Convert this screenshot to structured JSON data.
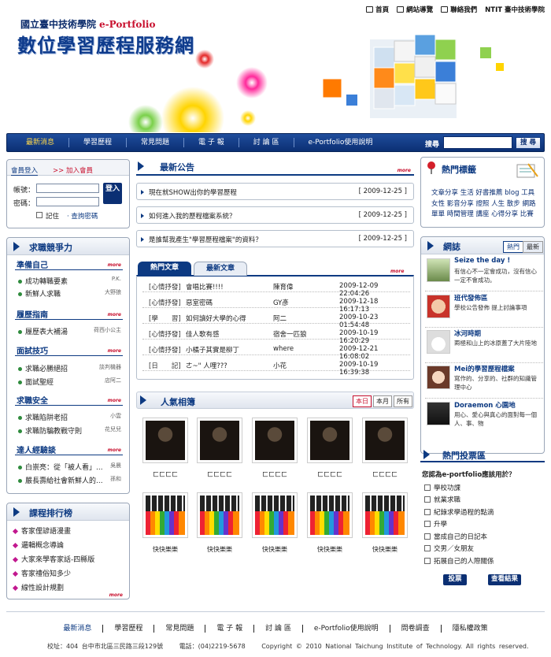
{
  "top_nav": [
    {
      "label": "首頁",
      "icon": "home-icon"
    },
    {
      "label": "網站導覽",
      "icon": "sitemap-icon"
    },
    {
      "label": "聯絡我們",
      "icon": "mail-icon"
    },
    {
      "label": "NTIT 臺中技術學院",
      "icon": ""
    }
  ],
  "header": {
    "school": "國立臺中技術學院",
    "eportfolio": "e-Portfolio",
    "site_title": "數位學習歷程服務網"
  },
  "main_nav": [
    "最新消息",
    "學習歷程",
    "常見問題",
    "電 子 報",
    "討 論 區",
    "e-Portfolio使用說明"
  ],
  "search": {
    "label": "搜尋",
    "button": "搜 尋"
  },
  "login": {
    "tab_active": "會員登入",
    "tab_other": ">> 加入會員",
    "account_label": "帳號：",
    "password_label": "密碼：",
    "remember": "記住",
    "forgot": "· 查詢密碼",
    "button": "登入"
  },
  "career": {
    "title": "求職競爭力",
    "more": "more",
    "sections": [
      {
        "title": "準備自己",
        "items": [
          {
            "t": "成功轉職要素",
            "a": "P.K."
          },
          {
            "t": "新鮮人求職",
            "a": "大野狼"
          }
        ]
      },
      {
        "title": "履歷指南",
        "items": [
          {
            "t": "履歷表大補湯",
            "a": "荷西小公主"
          }
        ]
      },
      {
        "title": "面試技巧",
        "items": [
          {
            "t": "求職必勝絕招",
            "a": "談判機器"
          },
          {
            "t": "面試聖經",
            "a": "店阿二"
          }
        ]
      },
      {
        "title": "求職安全",
        "items": [
          {
            "t": "求職陷阱老招",
            "a": "小雲"
          },
          {
            "t": "求職防騙教戰守則",
            "a": "花兒兒"
          }
        ]
      },
      {
        "title": "達人經驗談",
        "items": [
          {
            "t": "白崇亮：從「被人看」...",
            "a": "吳晨"
          },
          {
            "t": "嚴長壽給社會新鮮人的...",
            "a": "孫和"
          }
        ]
      }
    ]
  },
  "ranking": {
    "title": "課程排行榜",
    "more": "more",
    "items": [
      "客家俚諺語漫畫",
      "邏輯概念導論",
      "大家來學客家話-四縣版",
      "客家禮俗知多少",
      "線性設計規劃"
    ]
  },
  "news": {
    "title": "最新公告",
    "more": "more",
    "items": [
      {
        "title": "現在就SHOW出你的學習歷程",
        "date": "[ 2009-12-25 ]"
      },
      {
        "title": "如何進入我的歷程檔案系統？",
        "date": "[ 2009-12-25 ]"
      },
      {
        "title": "是誰幫我產生\"學習歷程檔案\"的資料？",
        "date": "[ 2009-12-25 ]"
      }
    ]
  },
  "articles": {
    "tabs": [
      "熱門文章",
      "最新文章"
    ],
    "more": "more",
    "rows": [
      {
        "cat": "[心情抒發]",
        "title": "會唱比賽!!!!",
        "author": "陳育偉",
        "time": "2009-12-09 22:04:26"
      },
      {
        "cat": "[心情抒發]",
        "title": "惡室密碼",
        "author": "GY彥",
        "time": "2009-12-18 16:17:13"
      },
      {
        "cat": "[學　　習]",
        "title": "如何讀好大學的心得",
        "author": "阿二",
        "time": "2009-10-23 01:54:48"
      },
      {
        "cat": "[心情抒發]",
        "title": "佳人歌有感",
        "author": "宿舍一匹狼",
        "time": "2009-10-19 16:20:29"
      },
      {
        "cat": "[心情抒發]",
        "title": "小橘子其實是柳丁",
        "author": "where",
        "time": "2009-12-21 16:08:02"
      },
      {
        "cat": "[日　　記]",
        "title": "ㄜ~\" 人哩???",
        "author": "小花",
        "time": "2009-10-19 16:39:38"
      }
    ]
  },
  "albums": {
    "title": "人氣相簿",
    "tabs": [
      "本日",
      "本月",
      "所有"
    ],
    "row1_label": "ㄈㄈㄈㄈ",
    "row2_label": "快快樂樂"
  },
  "hot_tags": {
    "title": "熱門標籤",
    "text": "文章分享 生活 好書推薦 blog 工具 女性 影音分享 證照 人生 散步 網路 單單 時間管理 講座 心得分享 比賽"
  },
  "blogs": {
    "title": "網誌",
    "tabs": [
      "熱門",
      "最新"
    ],
    "items": [
      {
        "title": "Seize the day !",
        "desc": "有信心不一定會成功，沒有信心一定不會成功。"
      },
      {
        "title": "班代發佈區",
        "desc": "學校公告發佈 提上討論事項"
      },
      {
        "title": "冰河時期",
        "desc": "兩極和山上的冰原蓋了大片陸地"
      },
      {
        "title": "Mei的學習歷程檔案",
        "desc": "寫作的、分享的、社群的知識管理中心"
      },
      {
        "title": "Doraemon 心園地",
        "desc": "用心、愛心與真心的面對每一個人、事、物"
      }
    ]
  },
  "poll": {
    "title": "熱門投票區",
    "question": "您認為e-portfolio應該用於？",
    "options": [
      "學校功課",
      "就業求職",
      "紀錄求學過程的點滴",
      "升學",
      "當成自己的日記本",
      "交男／女朋友",
      "拓展自己的人際關係"
    ],
    "vote_button": "投票",
    "result_button": "查看結果"
  },
  "footer": {
    "nav": [
      "最新消息",
      "學習歷程",
      "常見問題",
      "電 子 報",
      "討 論 區",
      "e-Portfolio使用說明",
      "問卷調查",
      "隱私權政策"
    ],
    "address": "校址：404 台中市北區三民路三段129號",
    "phone": "電話：(04)2219-5678",
    "copyright": "Copyright © 2010 National Taichung Institute of Technology. All rights reserved."
  }
}
